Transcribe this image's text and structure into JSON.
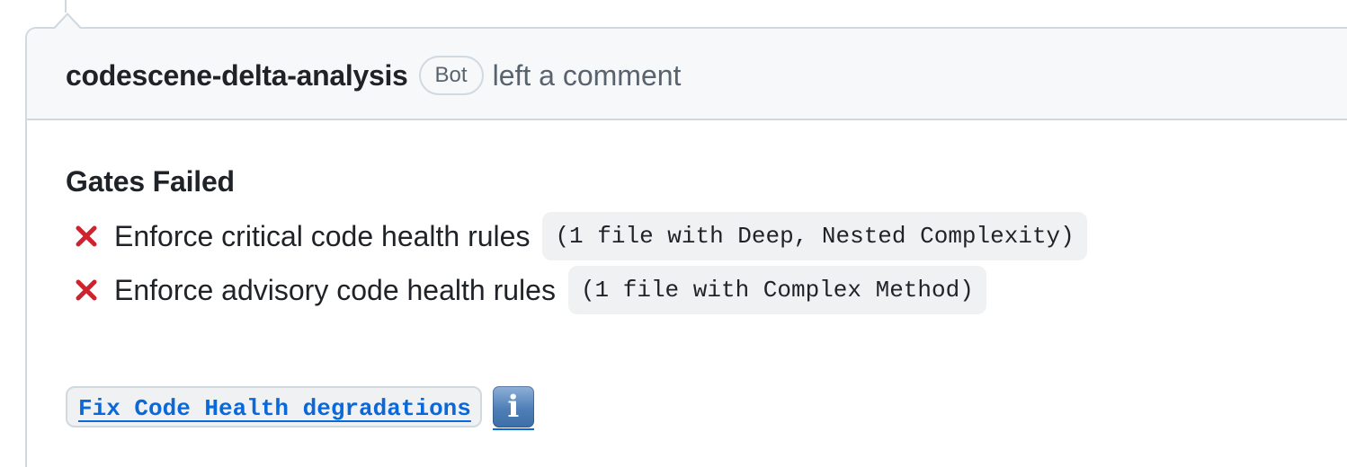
{
  "comment": {
    "author": "codescene-delta-analysis",
    "badge": "Bot",
    "action": "left a comment"
  },
  "body": {
    "gates_title": "Gates Failed",
    "gates": [
      {
        "status": "failed",
        "label": "Enforce critical code health rules",
        "detail": "(1 file with Deep, Nested Complexity)"
      },
      {
        "status": "failed",
        "label": "Enforce advisory code health rules",
        "detail": "(1 file with Complex Method)"
      }
    ],
    "fix_link": "Fix Code Health degradations",
    "info_icon": "i"
  },
  "icons": {
    "gate_failed": "x-icon",
    "info": "info-icon"
  },
  "colors": {
    "fail_red": "#cf222e",
    "link_blue": "#0969da",
    "border": "#d1d9e0",
    "header_bg": "#f6f8fa",
    "code_bg": "#eff1f3"
  }
}
